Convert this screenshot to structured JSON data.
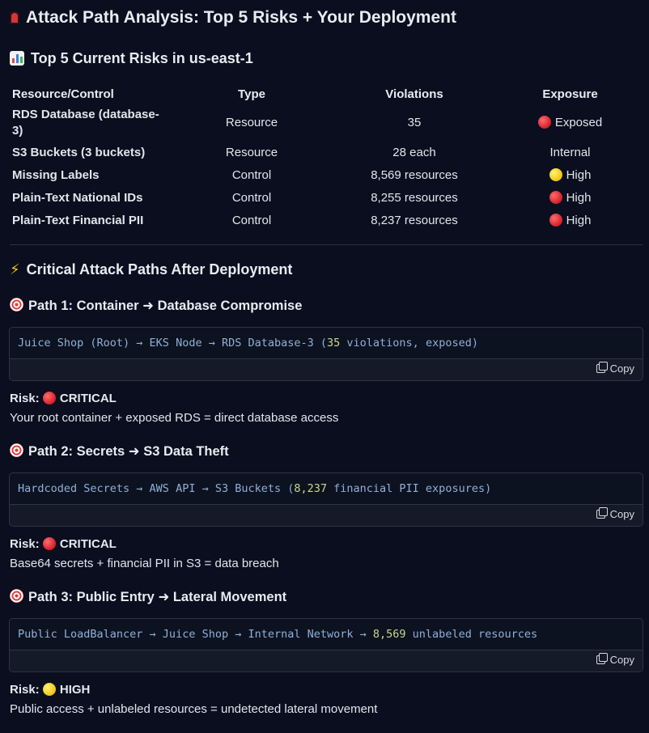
{
  "title": "Attack Path Analysis: Top 5 Risks + Your Deployment",
  "risks_heading": "Top 5 Current Risks in us-east-1",
  "table": {
    "headers": [
      "Resource/Control",
      "Type",
      "Violations",
      "Exposure"
    ],
    "rows": [
      {
        "resource": "RDS Database (database-3)",
        "type": "Resource",
        "violations": "35",
        "exposure": "Exposed",
        "dot": "red"
      },
      {
        "resource": "S3 Buckets (3 buckets)",
        "type": "Resource",
        "violations": "28 each",
        "exposure": "Internal",
        "dot": ""
      },
      {
        "resource": "Missing Labels",
        "type": "Control",
        "violations": "8,569 resources",
        "exposure": "High",
        "dot": "yellow"
      },
      {
        "resource": "Plain-Text National IDs",
        "type": "Control",
        "violations": "8,255 resources",
        "exposure": "High",
        "dot": "red"
      },
      {
        "resource": "Plain-Text Financial PII",
        "type": "Control",
        "violations": "8,237 resources",
        "exposure": "High",
        "dot": "red"
      }
    ]
  },
  "paths_heading": "Critical Attack Paths After Deployment",
  "paths": [
    {
      "title": "Path 1: Container ➜ Database Compromise",
      "code_pre": "Juice Shop (Root) → EKS Node → RDS Database-3 (",
      "code_num": "35",
      "code_post": " violations, exposed)",
      "risk_label": "Risk:",
      "risk_level": "CRITICAL",
      "risk_dot": "red",
      "description": "Your root container + exposed RDS = direct database access"
    },
    {
      "title": "Path 2: Secrets ➜ S3 Data Theft",
      "code_pre": "Hardcoded Secrets → AWS API → S3 Buckets (",
      "code_num": "8,237",
      "code_post": " financial PII exposures)",
      "risk_label": "Risk:",
      "risk_level": "CRITICAL",
      "risk_dot": "red",
      "description": "Base64 secrets + financial PII in S3 = data breach"
    },
    {
      "title": "Path 3: Public Entry ➜ Lateral Movement",
      "code_pre": "Public LoadBalancer → Juice Shop → Internal Network → ",
      "code_num": "8,569",
      "code_post": " unlabeled resources",
      "risk_label": "Risk:",
      "risk_level": "HIGH",
      "risk_dot": "yellow",
      "description": "Public access + unlabeled resources = undetected lateral movement"
    }
  ],
  "copy_label": "Copy",
  "icons": {
    "title": "siren-icon",
    "risks": "bar-chart-icon",
    "paths": "lightning-icon",
    "path": "target-icon",
    "copy": "copy-icon"
  },
  "colors": {
    "background": "#0a0e1f",
    "code_text": "#8fb0d8",
    "code_number": "#c9d98a",
    "red_dot": "#d21f2b",
    "yellow_dot": "#f0c30f"
  }
}
